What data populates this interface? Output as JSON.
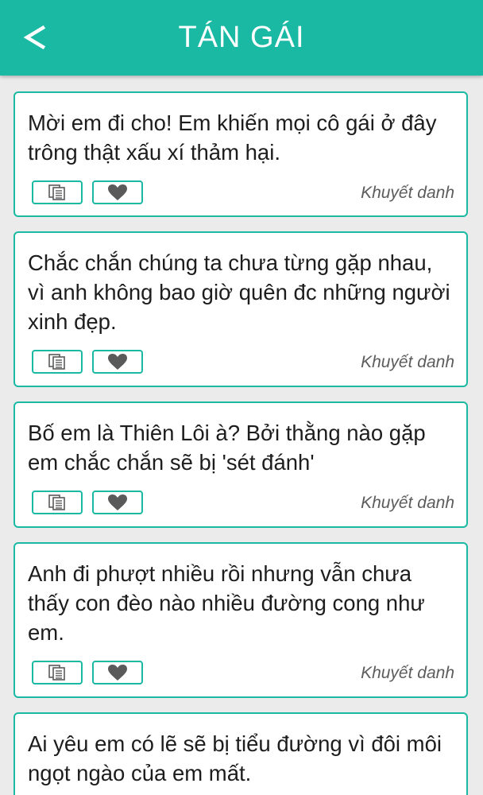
{
  "header": {
    "back_glyph": "<",
    "title": "TÁN GÁI"
  },
  "icons": {
    "copy": "copy-icon",
    "favorite": "heart-icon"
  },
  "colors": {
    "accent": "#1ab9a4",
    "icon": "#5a5a5a",
    "background": "#ebebeb"
  },
  "quotes": [
    {
      "text": "Mời em đi cho! Em khiến mọi cô gái ở đây trông thật xấu xí thảm hại.",
      "author": "Khuyết danh"
    },
    {
      "text": "Chắc chắn chúng ta chưa từng gặp nhau, vì anh không bao giờ quên đc những người xinh đẹp.",
      "author": "Khuyết danh"
    },
    {
      "text": "Bố em là Thiên Lôi à? Bởi thằng nào gặp em chắc chắn sẽ bị 'sét đánh'",
      "author": "Khuyết danh"
    },
    {
      "text": "Anh đi phượt nhiều rồi nhưng vẫn chưa thấy con đèo nào nhiều đường cong như em.",
      "author": "Khuyết danh"
    },
    {
      "text": "Ai yêu em có lẽ sẽ bị tiểu đường vì đôi môi ngọt ngào của em mất.",
      "author": ""
    }
  ]
}
